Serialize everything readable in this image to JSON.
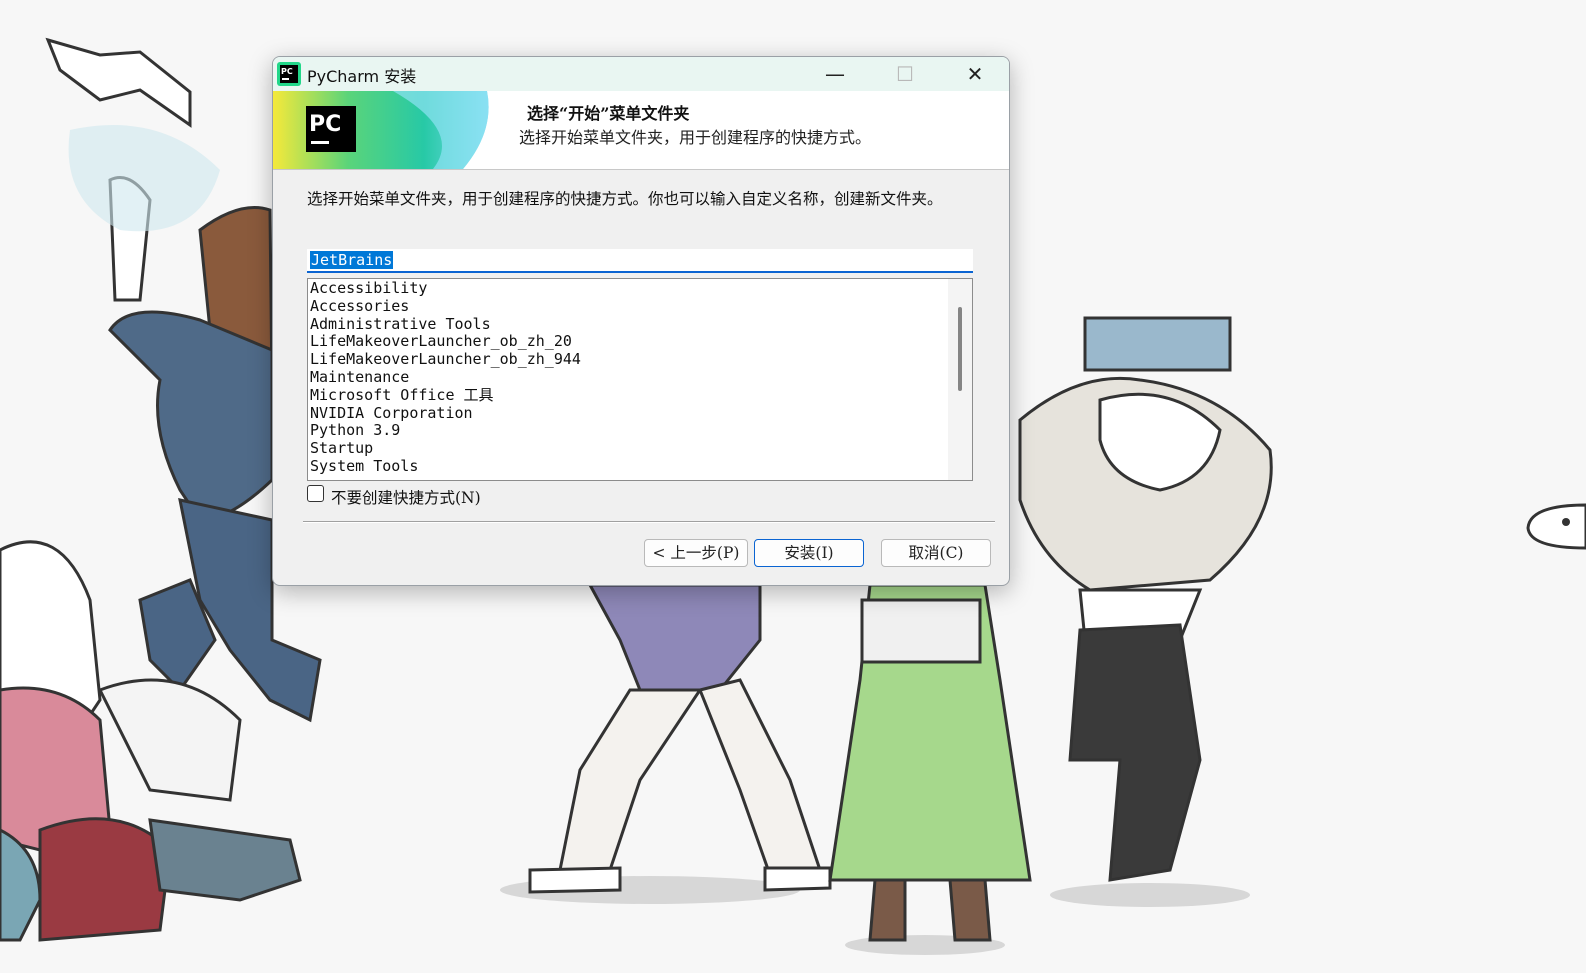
{
  "window": {
    "title": "PyCharm 安装",
    "icon": "pycharm-icon",
    "controls": {
      "minimize_glyph": "—",
      "maximize_glyph": "☐",
      "close_glyph": "✕"
    }
  },
  "banner": {
    "logo_text": "PC",
    "title": "选择“开始”菜单文件夹",
    "subtitle": "选择开始菜单文件夹，用于创建程序的快捷方式。"
  },
  "main": {
    "description": "选择开始菜单文件夹，用于创建程序的快捷方式。你也可以输入自定义名称，创建新文件夹。",
    "folder_input_value": "JetBrains",
    "folder_list": [
      "Accessibility",
      "Accessories",
      "Administrative Tools",
      "LifeMakeoverLauncher_ob_zh_20",
      "LifeMakeoverLauncher_ob_zh_944",
      "Maintenance",
      "Microsoft Office 工具",
      "NVIDIA Corporation",
      "Python 3.9",
      "Startup",
      "System Tools"
    ],
    "no_shortcut_label": "不要创建快捷方式(N)",
    "no_shortcut_checked": false
  },
  "buttons": {
    "back": "< 上一步(P)",
    "install": "安装(I)",
    "cancel": "取消(C)"
  },
  "colors": {
    "accent": "#0a64d2",
    "selection": "#0078d7",
    "titlebar": "#e9f6f2"
  }
}
